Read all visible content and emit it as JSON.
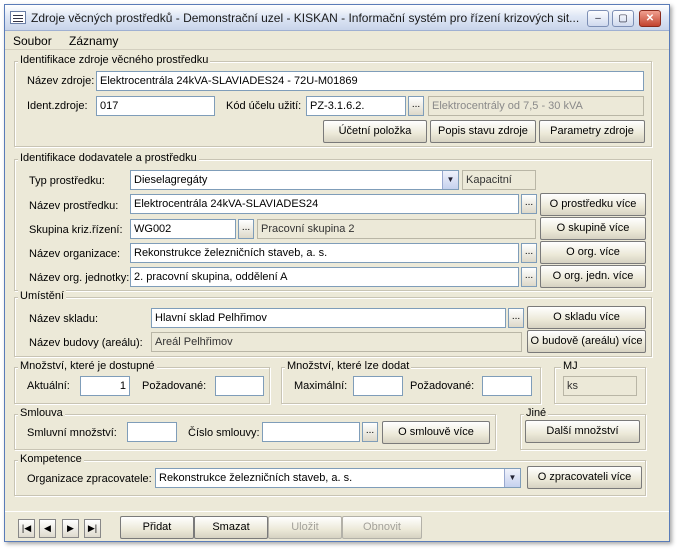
{
  "window": {
    "title": "Zdroje věcných prostředků - Demonstrační uzel - KISKAN - Informační systém pro řízení krizových sit...",
    "minimize": "‒",
    "maximize": "▢",
    "close": "✕"
  },
  "menu": {
    "file": "Soubor",
    "records": "Záznamy"
  },
  "resource_id": {
    "legend": "Identifikace zdroje věcného prostředku",
    "name_label": "Název zdroje:",
    "name_value": "Elektrocentrála 24kVA-SLAVIADES24 - 72U-M01869",
    "ident_label": "Ident.zdroje:",
    "ident_value": "017",
    "purpose_code_label": "Kód účelu užití:",
    "purpose_code_value": "PZ-3.1.6.2.",
    "purpose_desc_value": "Elektrocentrály od 7,5 - 30 kVA",
    "btn_accounting": "Účetní položka",
    "btn_state": "Popis stavu zdroje",
    "btn_params": "Parametry zdroje"
  },
  "supplier": {
    "legend": "Identifikace dodavatele a prostředku",
    "type_label": "Typ prostředku:",
    "type_value": "Dieselagregáty",
    "capacity_value": "Kapacitní",
    "means_label": "Název prostředku:",
    "means_value": "Elektrocentrála 24kVA-SLAVIADES24",
    "btn_means_more": "O prostředku více",
    "group_label": "Skupina kriz.řízení:",
    "group_code": "WG002",
    "group_name": "Pracovní skupina 2",
    "btn_group_more": "O skupině více",
    "org_label": "Název organizace:",
    "org_value": "Rekonstrukce železničních staveb, a. s.",
    "btn_org_more": "O org. více",
    "unit_label": "Název org. jednotky:",
    "unit_value": "2. pracovní skupina, oddělení A",
    "btn_unit_more": "O org. jedn. více"
  },
  "location": {
    "legend": "Umístění",
    "warehouse_label": "Název skladu:",
    "warehouse_value": "Hlavní sklad Pelhřimov",
    "btn_warehouse_more": "O skladu více",
    "building_label": "Název budovy (areálu):",
    "building_value": "Areál Pelhřimov",
    "btn_building_more": "O budově (areálu) více"
  },
  "available": {
    "legend": "Množství, které je dostupné",
    "current_label": "Aktuální:",
    "current_value": "1",
    "required_label": "Požadované:",
    "required_value": ""
  },
  "deliverable": {
    "legend": "Množství, které lze dodat",
    "max_label": "Maximální:",
    "max_value": "",
    "required_label": "Požadované:",
    "required_value": ""
  },
  "unit": {
    "legend": "MJ",
    "value": "ks"
  },
  "contract": {
    "legend": "Smlouva",
    "qty_label": "Smluvní množství:",
    "qty_value": "",
    "number_label": "Číslo smlouvy:",
    "number_value": "",
    "btn_more": "O smlouvě více"
  },
  "other": {
    "legend": "Jiné",
    "btn_more_qty": "Další množství"
  },
  "competence": {
    "legend": "Kompetence",
    "org_label": "Organizace zpracovatele:",
    "org_value": "Rekonstrukce železničních staveb, a. s.",
    "btn_more": "O zpracovateli více"
  },
  "nav": {
    "first": "|◀",
    "prev": "◀",
    "next": "▶",
    "last": "▶|",
    "add": "Přidat",
    "delete": "Smazat",
    "save": "Uložit",
    "refresh": "Obnovit"
  },
  "icons": {
    "ellipsis": "...",
    "dropdown": "▼"
  }
}
